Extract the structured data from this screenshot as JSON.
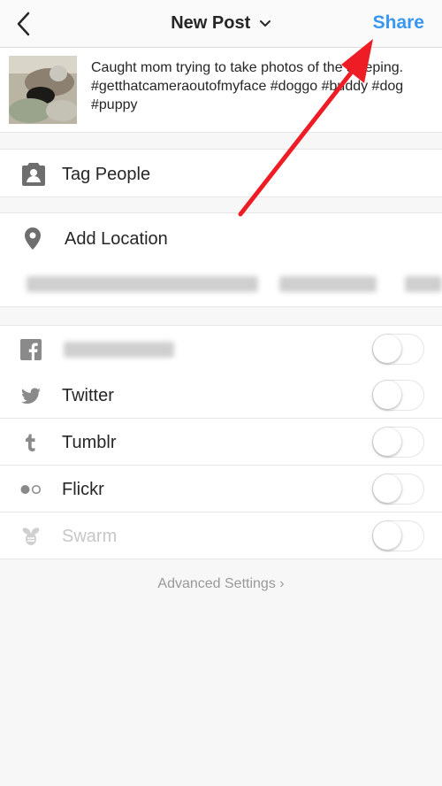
{
  "header": {
    "title": "New Post",
    "share_label": "Share",
    "accent_color": "#3897f0"
  },
  "post": {
    "caption": "Caught mom trying to take photos of the sleeping. #getthatcameraoutofmyface #doggo #buddy #dog #puppy"
  },
  "options": {
    "tag_people": "Tag People",
    "add_location": "Add Location"
  },
  "share_to": [
    {
      "icon": "facebook-icon",
      "label": "",
      "enabled": false
    },
    {
      "icon": "twitter-icon",
      "label": "Twitter",
      "enabled": false
    },
    {
      "icon": "tumblr-icon",
      "label": "Tumblr",
      "enabled": false
    },
    {
      "icon": "flickr-icon",
      "label": "Flickr",
      "enabled": false
    },
    {
      "icon": "swarm-icon",
      "label": "Swarm",
      "enabled": false
    }
  ],
  "footer": {
    "advanced_settings": "Advanced Settings ›"
  },
  "annotation": {
    "color": "#ee1c24"
  }
}
